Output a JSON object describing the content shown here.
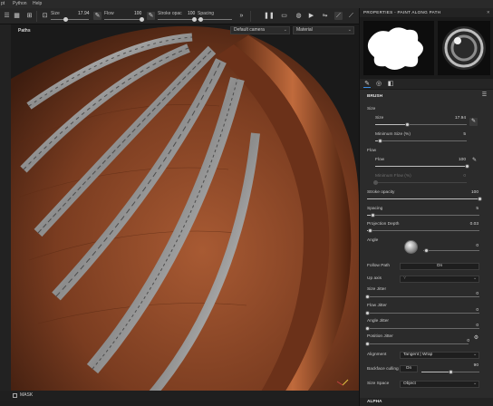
{
  "menu": {
    "item1": "pt",
    "item2": "Python",
    "item3": "Help"
  },
  "toolbar": {
    "size_label": "Size",
    "size_value": "17.94",
    "flow_label": "Flow",
    "flow_value": "100",
    "stroke_label": "Stroke opac",
    "stroke_value": "100",
    "spacing_label": "Spacing"
  },
  "viewport": {
    "paths_label": "Paths",
    "camera_select": "Default camera",
    "material_select": "Material"
  },
  "bottom": {
    "mask_label": "MASK"
  },
  "panel": {
    "title": "PROPERTIES - PAINT ALONG PATH",
    "brush_title": "BRUSH",
    "size_section": "Size",
    "size_label": "Size",
    "size_value": "17.94",
    "size_fraction": 0.35,
    "min_size_label": "Minimum Size (%)",
    "min_size_value": "5",
    "min_size_fraction": 0.05,
    "flow_section": "Flow",
    "flow_label": "Flow",
    "flow_value": "100",
    "flow_fraction": 1.0,
    "min_flow_label": "Minimum Flow (%)",
    "min_flow_value": "0",
    "stroke_opacity_label": "Stroke opacity",
    "stroke_opacity_value": "100",
    "stroke_opacity_fraction": 1.0,
    "spacing_label": "Spacing",
    "spacing_value": "5",
    "spacing_fraction": 0.05,
    "projection_depth_label": "Projection Depth",
    "projection_depth_value": "0.03",
    "projection_depth_fraction": 0.03,
    "angle_label": "Angle",
    "angle_value": "0",
    "follow_path_label": "Follow Path",
    "follow_path_value": "On",
    "up_axis_label": "Up axis",
    "up_axis_value": "Y",
    "size_jitter_label": "Size Jitter",
    "size_jitter_value": "0",
    "flow_jitter_label": "Flow Jitter",
    "flow_jitter_value": "0",
    "angle_jitter_label": "Angle Jitter",
    "angle_jitter_value": "0",
    "position_jitter_label": "Position Jitter",
    "position_jitter_value": "0",
    "alignment_label": "Alignment",
    "alignment_value": "Tangent | Wrap",
    "backface_label": "Backface culling",
    "backface_toggle": "On",
    "backface_value": "90",
    "backface_fraction": 0.5,
    "size_space_label": "Size Space",
    "size_space_value": "Object",
    "alpha_title": "ALPHA"
  }
}
